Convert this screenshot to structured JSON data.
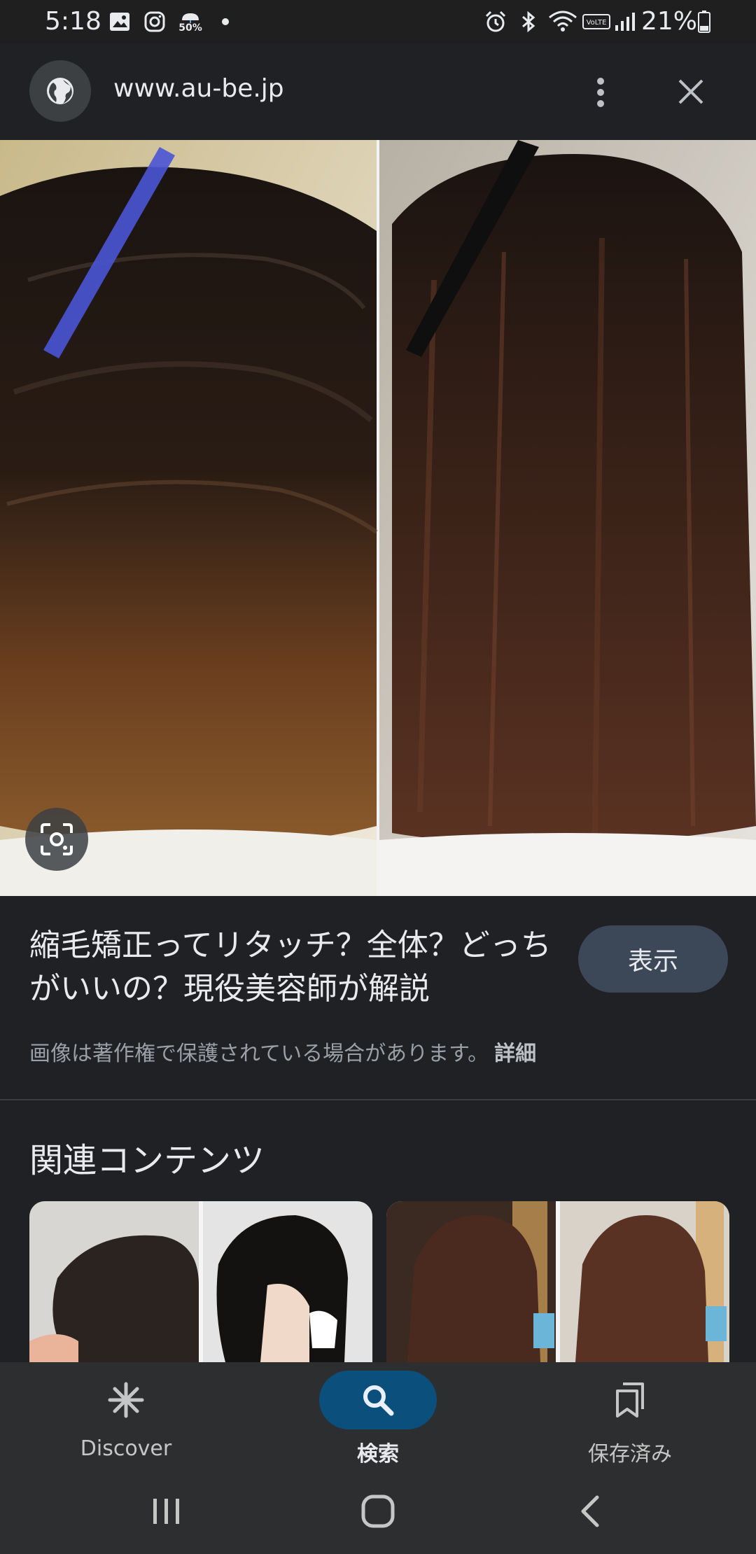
{
  "status_bar": {
    "time": "5:18",
    "precip_badge": "50%",
    "battery_percent": "21%",
    "icons": [
      "gallery-icon",
      "instagram-icon",
      "weather-icon",
      "dot-icon",
      "alarm-icon",
      "bluetooth-icon",
      "wifi-icon",
      "volte-icon",
      "signal-icon",
      "battery-icon"
    ]
  },
  "header": {
    "url": "www.au-be.jp",
    "icons": [
      "globe-icon",
      "more-vert-icon",
      "close-icon"
    ]
  },
  "result": {
    "title": "縮毛矯正ってリタッチ？全体？どっちがいいの？現役美容師が解説",
    "view_button": "表示",
    "copyright_text": "画像は著作権で保護されている場合があります。",
    "details_link": "詳細"
  },
  "related": {
    "title": "関連コンテンツ"
  },
  "bottom_nav": {
    "items": [
      {
        "label": "Discover",
        "icon": "asterisk-icon",
        "active": false
      },
      {
        "label": "検索",
        "icon": "search-icon",
        "active": true
      },
      {
        "label": "保存済み",
        "icon": "saved-icon",
        "active": false
      }
    ]
  },
  "system_nav": {
    "icons": [
      "recents-icon",
      "home-icon",
      "back-icon"
    ]
  },
  "colors": {
    "background": "#202124",
    "active_pill": "#0b4f7c",
    "view_button": "#3c4758"
  }
}
